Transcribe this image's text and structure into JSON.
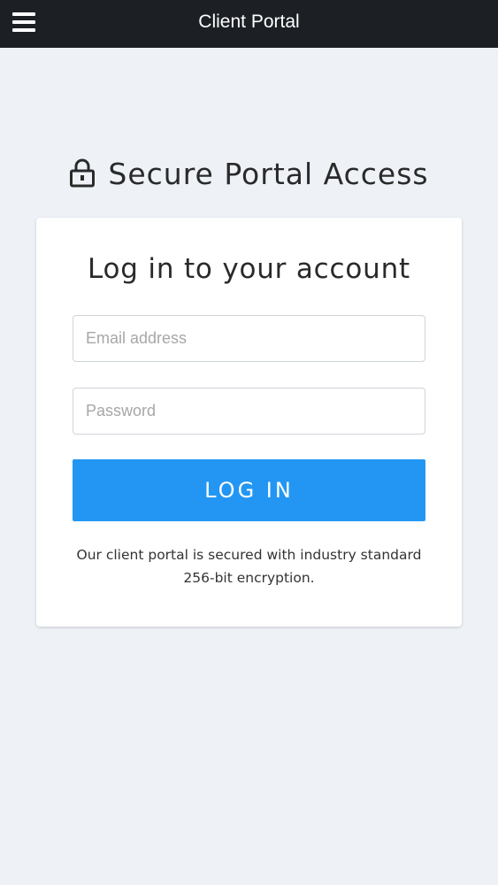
{
  "header": {
    "app_title": "Client Portal",
    "menu_icon": "hamburger-menu-icon"
  },
  "page": {
    "heading": "Secure Portal Access",
    "heading_icon": "lock-icon"
  },
  "login_form": {
    "title": "Log in to your account",
    "email_placeholder": "Email address",
    "email_value": "",
    "password_placeholder": "Password",
    "password_value": "",
    "submit_label": "LOG IN",
    "security_note": "Our client portal is secured with industry standard 256-bit encryption."
  },
  "colors": {
    "header_bg": "#1c2024",
    "page_bg": "#eef2f7",
    "accent": "#2396f3",
    "card_bg": "#ffffff"
  }
}
